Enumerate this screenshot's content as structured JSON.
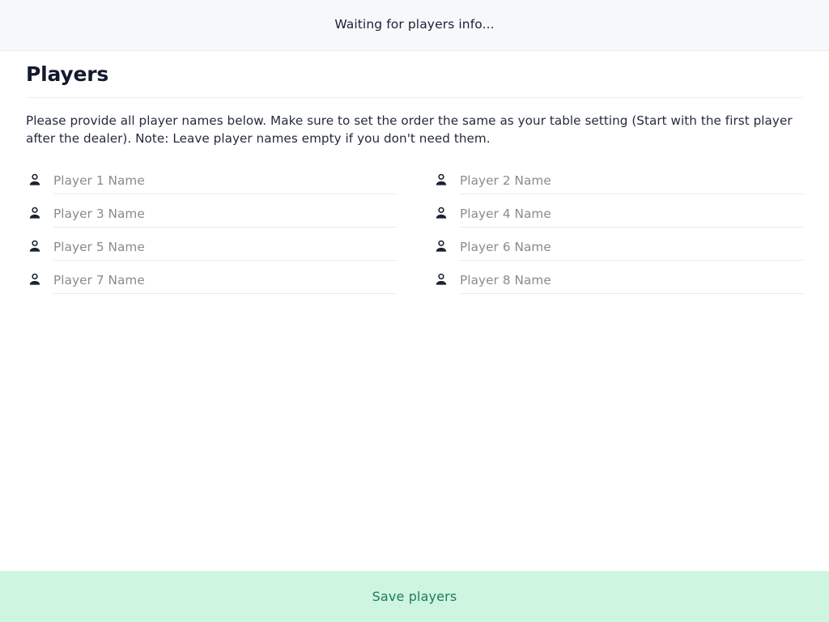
{
  "status_bar": {
    "message": "Waiting for players info..."
  },
  "page": {
    "title": "Players",
    "description": "Please provide all player names below. Make sure to set the order the same as your table setting (Start with the first player after the dealer). Note: Leave player names empty if you don't need them."
  },
  "players": [
    {
      "icon": "person-icon",
      "placeholder": "Player 1 Name",
      "value": ""
    },
    {
      "icon": "person-icon",
      "placeholder": "Player 2 Name",
      "value": ""
    },
    {
      "icon": "person-icon",
      "placeholder": "Player 3 Name",
      "value": ""
    },
    {
      "icon": "person-icon",
      "placeholder": "Player 4 Name",
      "value": ""
    },
    {
      "icon": "person-icon",
      "placeholder": "Player 5 Name",
      "value": ""
    },
    {
      "icon": "person-icon",
      "placeholder": "Player 6 Name",
      "value": ""
    },
    {
      "icon": "person-icon",
      "placeholder": "Player 7 Name",
      "value": ""
    },
    {
      "icon": "person-icon",
      "placeholder": "Player 8 Name",
      "value": ""
    }
  ],
  "footer": {
    "save_label": "Save players"
  },
  "colors": {
    "status_bar_bg": "#f7f8fa",
    "page_bg": "#ffffff",
    "text_primary": "#1b2135",
    "text_placeholder": "#8b8b8b",
    "divider": "#ebedef",
    "input_underline": "#e9ebed",
    "save_bar_bg": "#cdf5e0",
    "save_text": "#21795b"
  }
}
